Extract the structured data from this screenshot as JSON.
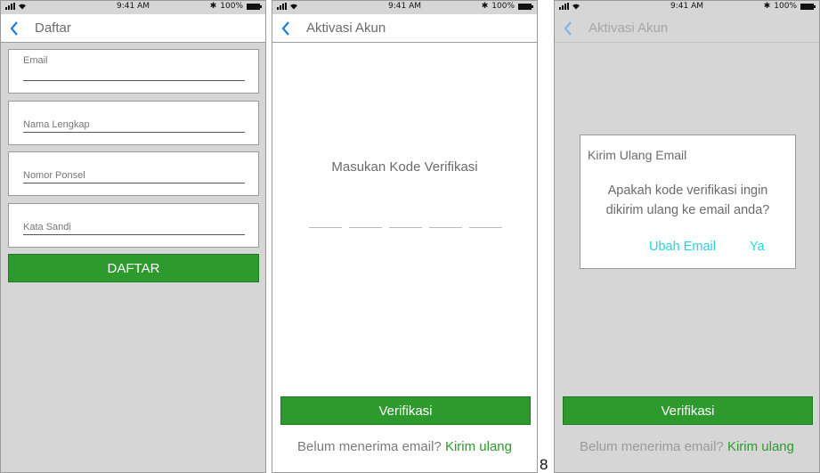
{
  "status": {
    "time": "9:41 AM",
    "battery": "100%"
  },
  "colors": {
    "accent_green": "#2e9a2e",
    "dialog_link": "#26d2e0",
    "back_arrow": "#1e7fd6"
  },
  "screen1": {
    "nav_title": "Daftar",
    "fields": [
      {
        "label": "Email"
      },
      {
        "label": "Nama Lengkap"
      },
      {
        "label": "Nomor Ponsel"
      },
      {
        "label": "Kata Sandi"
      }
    ],
    "submit_label": "DAFTAR"
  },
  "screen2": {
    "nav_title": "Aktivasi Akun",
    "code_title": "Masukan Kode Verifikasi",
    "code_length": 5,
    "verify_label": "Verifikasi",
    "resend_prompt": "Belum menerima email?",
    "resend_link": "Kirim ulang"
  },
  "screen3": {
    "nav_title": "Aktivasi Akun",
    "dialog": {
      "title": "Kirim Ulang Email",
      "message_line1": "Apakah kode verifikasi ingin",
      "message_line2": "dikirim ulang ke email anda?",
      "change_email": "Ubah Email",
      "confirm": "Ya"
    },
    "verify_label": "Verifikasi",
    "resend_prompt": "Belum menerima email?",
    "resend_link": "Kirim ulang"
  },
  "page_number": "8"
}
